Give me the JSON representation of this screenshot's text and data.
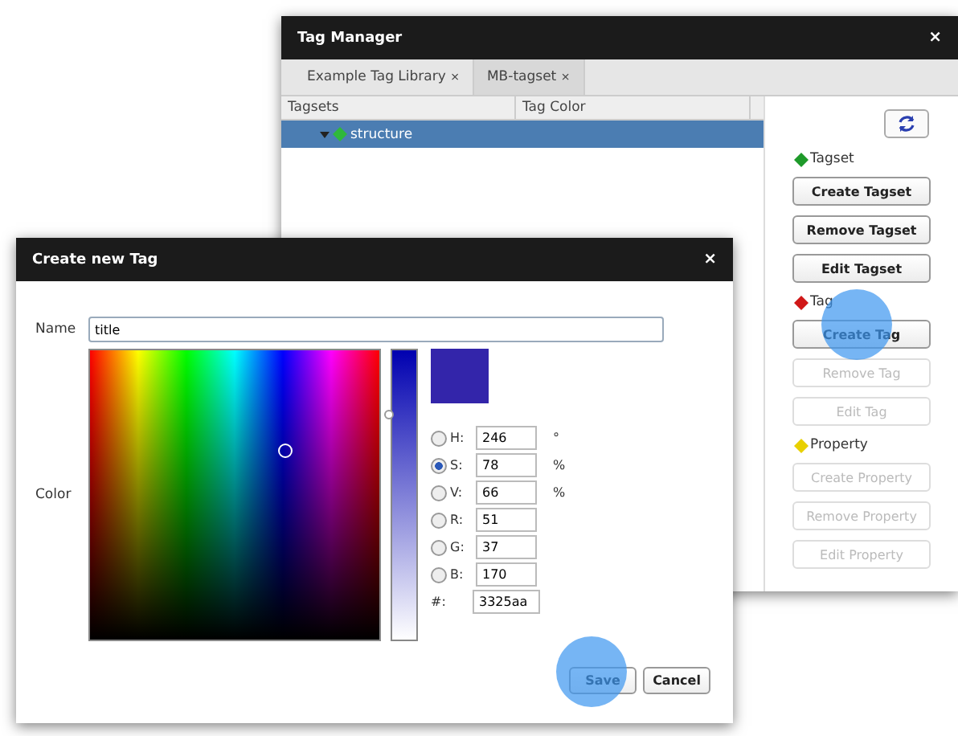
{
  "tag_manager": {
    "title": "Tag Manager",
    "close": "×",
    "tabs": [
      {
        "label": "Example Tag Library",
        "close": "×",
        "selected": false
      },
      {
        "label": "MB-tagset",
        "close": "×",
        "selected": true
      }
    ],
    "columns": [
      "Tagsets",
      "Tag Color"
    ],
    "rows": [
      {
        "name": "structure",
        "selected": true,
        "expanded": true
      }
    ],
    "sections": [
      {
        "title": "Tagset",
        "color": "#1e9a2a",
        "buttons": [
          {
            "label": "Create Tagset",
            "disabled": false
          },
          {
            "label": "Remove Tagset",
            "disabled": false
          },
          {
            "label": "Edit Tagset",
            "disabled": false
          }
        ]
      },
      {
        "title": "Tag",
        "color": "#d01818",
        "buttons": [
          {
            "label": "Create Tag",
            "disabled": false
          },
          {
            "label": "Remove Tag",
            "disabled": true
          },
          {
            "label": "Edit Tag",
            "disabled": true
          }
        ]
      },
      {
        "title": "Property",
        "color": "#e8d000",
        "buttons": [
          {
            "label": "Create Property",
            "disabled": true
          },
          {
            "label": "Remove Property",
            "disabled": true
          },
          {
            "label": "Edit Property",
            "disabled": true
          }
        ]
      }
    ]
  },
  "create_dialog": {
    "title": "Create new Tag",
    "close": "×",
    "name_label": "Name",
    "name_value": "title",
    "color_label": "Color",
    "fields": [
      {
        "label": "H:",
        "value": "246",
        "unit": "°",
        "selected": false
      },
      {
        "label": "S:",
        "value": "78",
        "unit": "%",
        "selected": true
      },
      {
        "label": "V:",
        "value": "66",
        "unit": "%",
        "selected": false
      },
      {
        "label": "R:",
        "value": "51",
        "selected": false
      },
      {
        "label": "G:",
        "value": "37",
        "selected": false
      },
      {
        "label": "B:",
        "value": "170",
        "selected": false
      }
    ],
    "hex": {
      "label": "#:",
      "value": "3325aa"
    },
    "hue_slider": {
      "level": 0.78
    },
    "buttons": [
      "Save",
      "Cancel"
    ]
  }
}
